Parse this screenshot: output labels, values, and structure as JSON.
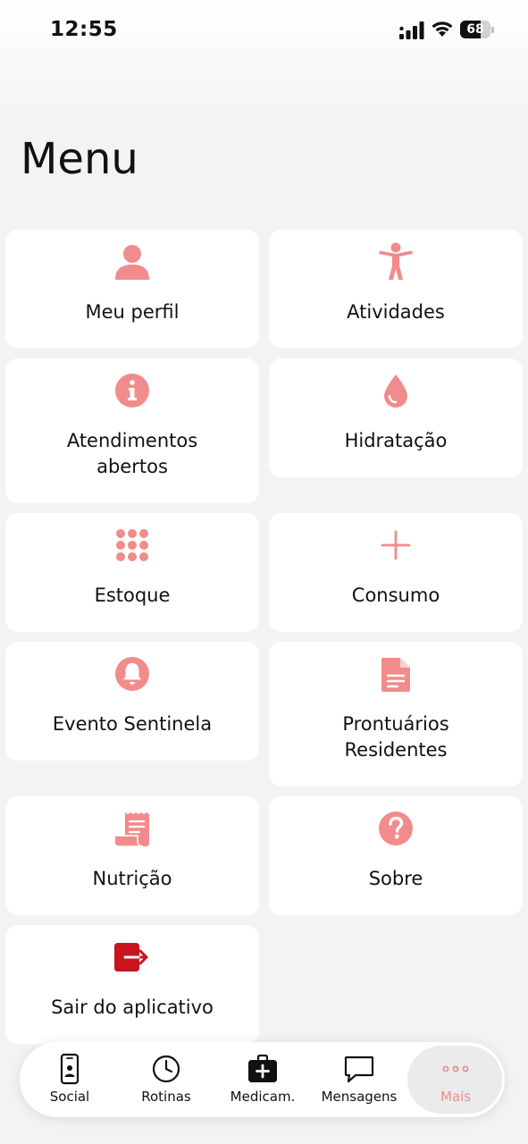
{
  "status_bar": {
    "time": "12:55",
    "battery": "68",
    "battery_level": 0.68
  },
  "title": "Menu",
  "colors": {
    "accent": "#f28b8b",
    "exit": "#c8141e",
    "active_tab": "#f08d8d"
  },
  "menu": [
    {
      "label": "Meu perfil",
      "icon": "user-icon"
    },
    {
      "label": "Atividades",
      "icon": "accessibility-icon"
    },
    {
      "label": "Atendimentos\nabertos",
      "icon": "info-icon"
    },
    {
      "label": "Hidratação",
      "icon": "water-drop-icon"
    },
    {
      "label": "Estoque",
      "icon": "grid-dots-icon"
    },
    {
      "label": "Consumo",
      "icon": "plus-icon"
    },
    {
      "label": "Evento Sentinela",
      "icon": "bell-icon"
    },
    {
      "label": "Prontuários\nResidentes",
      "icon": "document-icon"
    },
    {
      "label": "Nutrição",
      "icon": "receipt-icon"
    },
    {
      "label": "Sobre",
      "icon": "question-icon"
    },
    {
      "label": "Sair do aplicativo",
      "icon": "logout-icon"
    }
  ],
  "tabs": [
    {
      "label": "Social",
      "icon": "phone-user-icon"
    },
    {
      "label": "Rotinas",
      "icon": "clock-icon"
    },
    {
      "label": "Medicam.",
      "icon": "medkit-icon"
    },
    {
      "label": "Mensagens",
      "icon": "chat-icon"
    },
    {
      "label": "Mais",
      "icon": "more-dots-icon",
      "active": true
    }
  ]
}
